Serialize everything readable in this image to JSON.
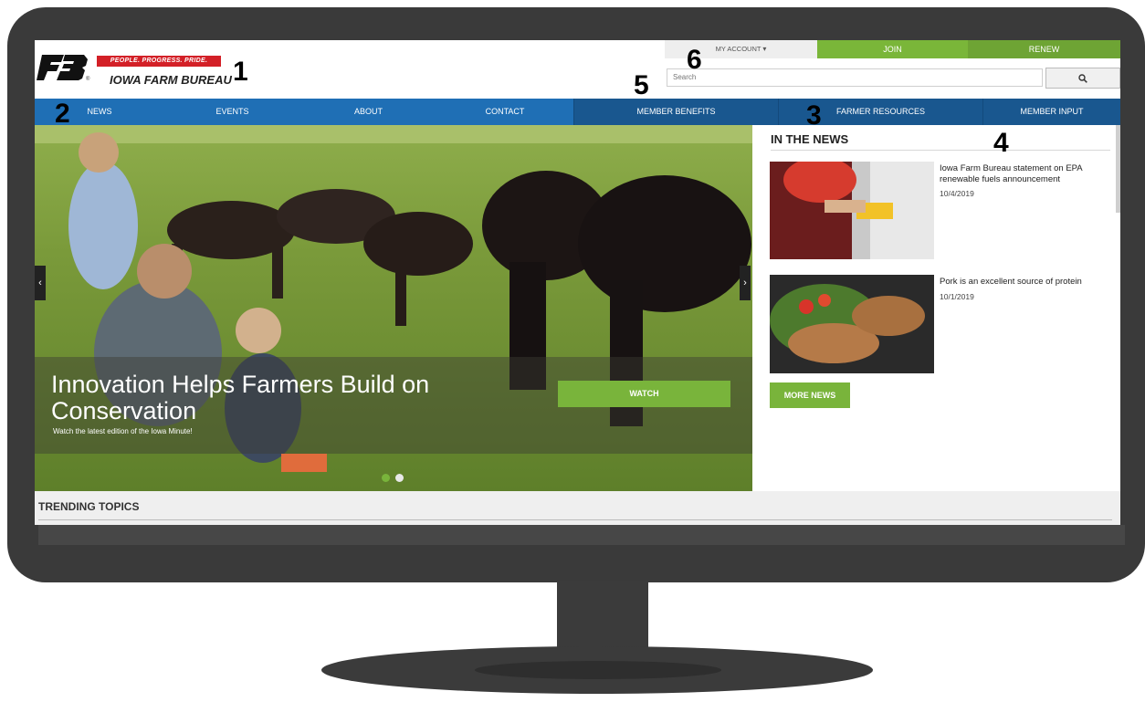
{
  "header": {
    "tagline": "PEOPLE. PROGRESS. PRIDE.",
    "org_name": "IOWA FARM BUREAU",
    "registered": "®"
  },
  "topbar": {
    "my_account": "MY ACCOUNT",
    "join": "JOIN",
    "renew": "RENEW"
  },
  "search": {
    "placeholder": "Search"
  },
  "nav": {
    "items": [
      "NEWS",
      "EVENTS",
      "ABOUT",
      "CONTACT",
      "MEMBER BENEFITS",
      "FARMER RESOURCES",
      "MEMBER INPUT"
    ]
  },
  "hero": {
    "title": "Innovation Helps Farmers Build on Conservation",
    "subtitle": "Watch the latest edition of the Iowa Minute!",
    "button": "WATCH"
  },
  "news": {
    "heading": "IN THE NEWS",
    "items": [
      {
        "title": "Iowa Farm Bureau statement on EPA renewable fuels announcement",
        "date": "10/4/2019"
      },
      {
        "title": "Pork is an excellent source of protein",
        "date": "10/1/2019"
      }
    ],
    "more": "MORE NEWS"
  },
  "trending": {
    "heading": "TRENDING TOPICS"
  },
  "annotations": [
    "1",
    "2",
    "3",
    "4",
    "5",
    "6"
  ],
  "icons": {
    "search": "search-icon",
    "chevron": "chevron-down-icon",
    "prev": "chevron-left-icon",
    "next": "chevron-right-icon"
  },
  "colors": {
    "nav_blue": "#1f6fb5",
    "nav_dark": "#19578f",
    "green": "#79b43b",
    "red": "#d32027",
    "bezel": "#3a3a3a"
  }
}
